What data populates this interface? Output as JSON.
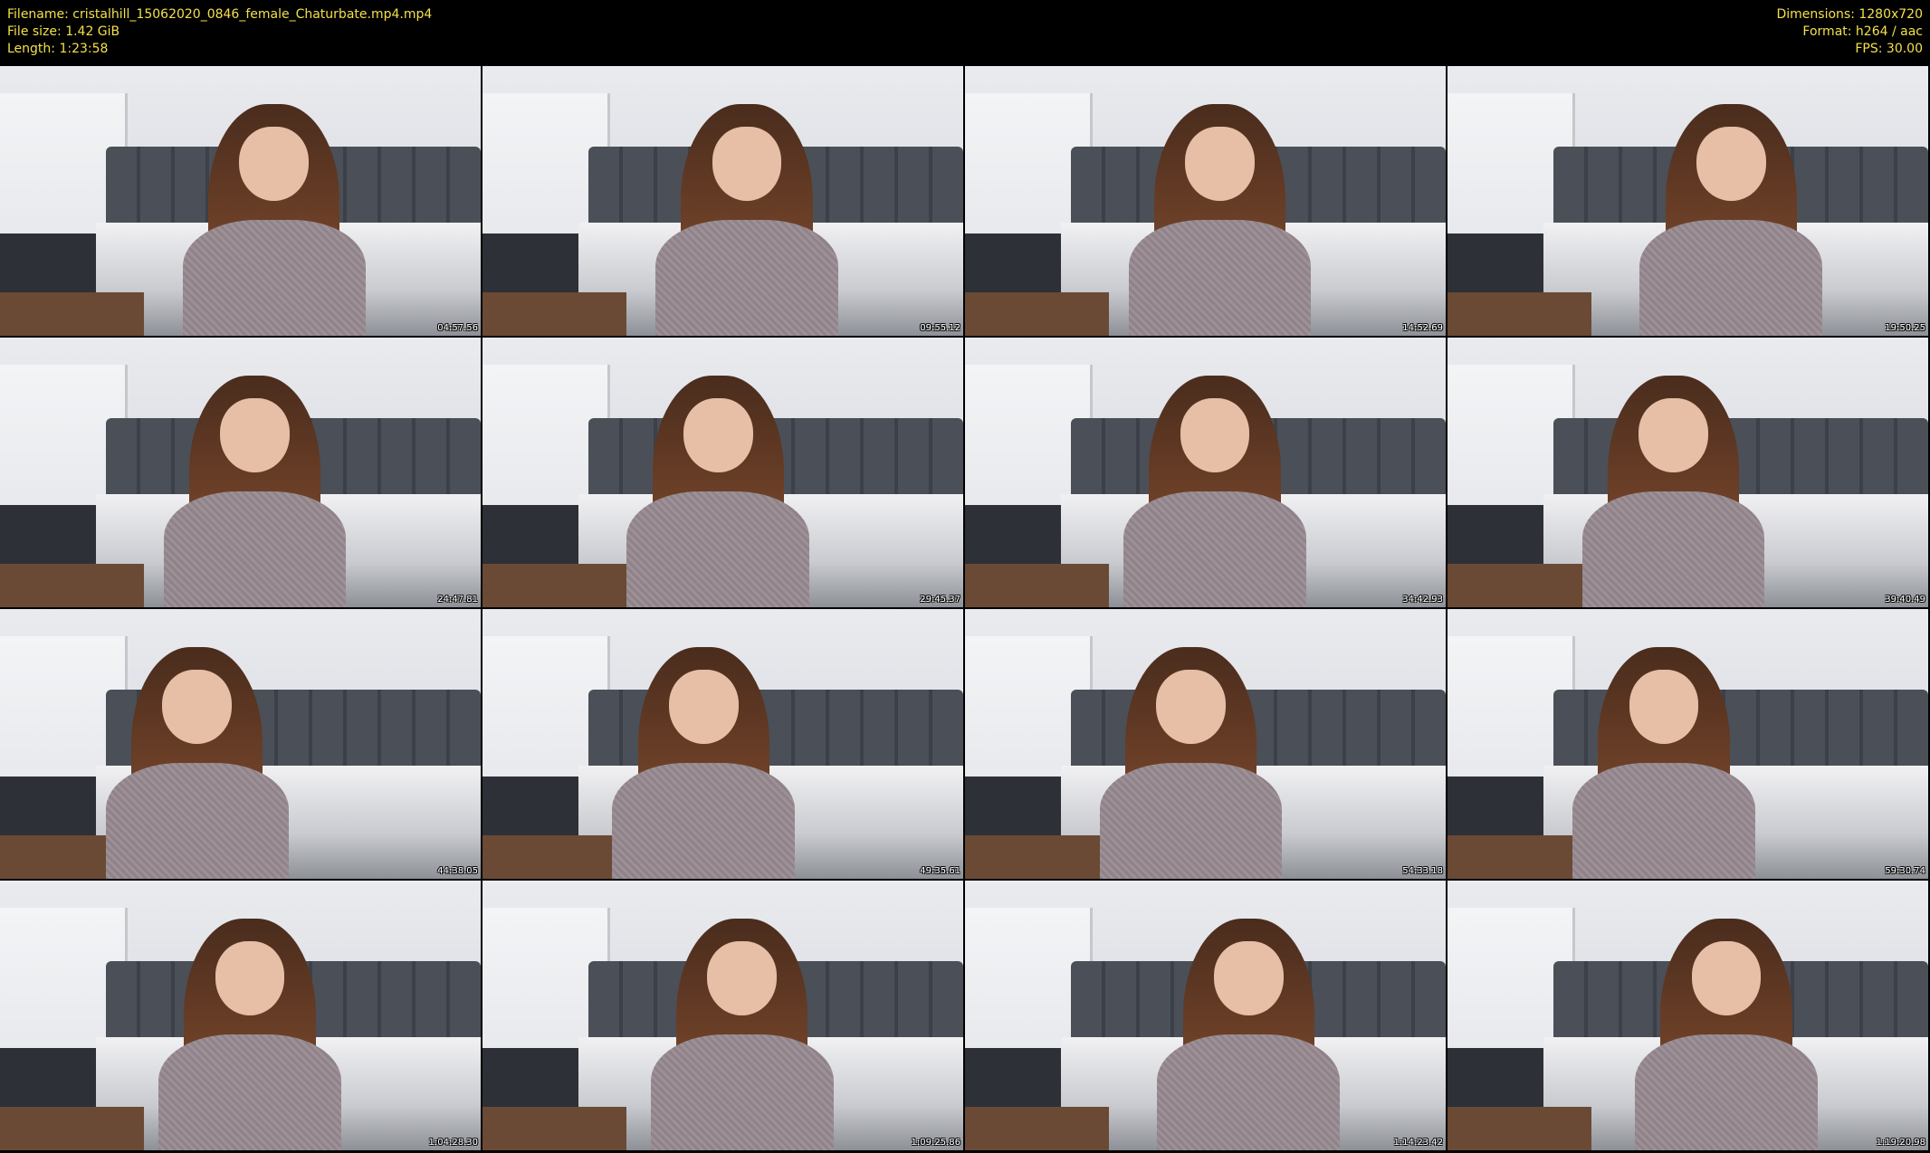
{
  "header": {
    "filename_label": "Filename: cristalhill_15062020_0846_female_Chaturbate.mp4.mp4",
    "filesize_label": "File size: 1.42 GiB",
    "length_label": "Length: 1:23:58",
    "dimensions_label": "Dimensions: 1280x720",
    "format_label": "Format: h264 / aac",
    "fps_label": "FPS: 30.00"
  },
  "thumbnails": [
    {
      "timestamp": "04:57.56"
    },
    {
      "timestamp": "09:55.12"
    },
    {
      "timestamp": "14:52.69"
    },
    {
      "timestamp": "19:50.25"
    },
    {
      "timestamp": "24:47.81"
    },
    {
      "timestamp": "29:45.37"
    },
    {
      "timestamp": "34:42.93"
    },
    {
      "timestamp": "39:40.49"
    },
    {
      "timestamp": "44:38.05"
    },
    {
      "timestamp": "49:35.61"
    },
    {
      "timestamp": "54:33.18"
    },
    {
      "timestamp": "59:30.74"
    },
    {
      "timestamp": "1:04:28.30"
    },
    {
      "timestamp": "1:09:25.86"
    },
    {
      "timestamp": "1:14:23.42"
    },
    {
      "timestamp": "1:19:20.98"
    }
  ],
  "colors": {
    "header_text": "#f2e04a",
    "background": "#000000"
  }
}
